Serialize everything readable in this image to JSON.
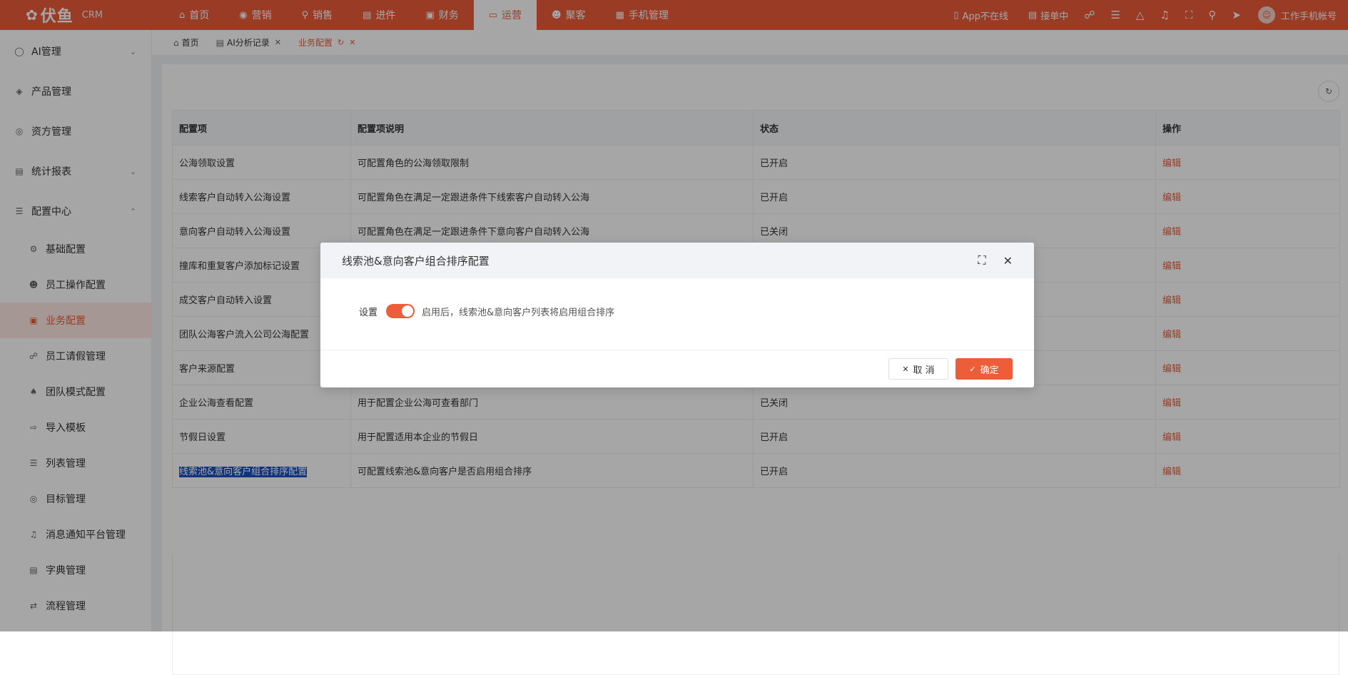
{
  "colors": {
    "brand": "#ed5d3a",
    "highlight": "#1a4fc4"
  },
  "brand": {
    "logo_text": "伏鱼",
    "product": "CRM"
  },
  "nav": [
    {
      "label": "首页",
      "icon": "home-icon"
    },
    {
      "label": "营销",
      "icon": "marketing-icon"
    },
    {
      "label": "销售",
      "icon": "sales-icon"
    },
    {
      "label": "进件",
      "icon": "document-icon"
    },
    {
      "label": "财务",
      "icon": "finance-icon"
    },
    {
      "label": "运营",
      "icon": "operations-icon",
      "active": true
    },
    {
      "label": "聚客",
      "icon": "customers-icon"
    },
    {
      "label": "手机管理",
      "icon": "phone-manage-icon"
    }
  ],
  "topbar": {
    "app_status": "App不在线",
    "order_status": "接单中",
    "account": "工作手机帐号"
  },
  "sidebar": [
    {
      "label": "AI管理",
      "icon": "ai-icon",
      "level": 1,
      "chevron": "down"
    },
    {
      "label": "产品管理",
      "icon": "cube-icon",
      "level": 1
    },
    {
      "label": "资方管理",
      "icon": "funder-icon",
      "level": 1
    },
    {
      "label": "统计报表",
      "icon": "chart-icon",
      "level": 1,
      "chevron": "down"
    },
    {
      "label": "配置中心",
      "icon": "config-icon",
      "level": 1,
      "chevron": "up"
    },
    {
      "label": "基础配置",
      "icon": "gear-icon",
      "level": 2
    },
    {
      "label": "员工操作配置",
      "icon": "user-icon",
      "level": 2
    },
    {
      "label": "业务配置",
      "icon": "briefcase-icon",
      "level": 2,
      "active": true
    },
    {
      "label": "员工请假管理",
      "icon": "leave-icon",
      "level": 2
    },
    {
      "label": "团队模式配置",
      "icon": "team-icon",
      "level": 2
    },
    {
      "label": "导入模板",
      "icon": "import-icon",
      "level": 2
    },
    {
      "label": "列表管理",
      "icon": "list-icon",
      "level": 2
    },
    {
      "label": "目标管理",
      "icon": "target-icon",
      "level": 2
    },
    {
      "label": "消息通知平台管理",
      "icon": "bell-icon",
      "level": 2
    },
    {
      "label": "字典管理",
      "icon": "dictionary-icon",
      "level": 2
    },
    {
      "label": "流程管理",
      "icon": "flow-icon",
      "level": 2
    }
  ],
  "tabs": [
    {
      "label": "首页",
      "icon": "home-icon",
      "closable": false
    },
    {
      "label": "AI分析记录",
      "icon": "record-icon",
      "closable": true
    },
    {
      "label": "业务配置",
      "closable": true,
      "active": true,
      "refresh": true
    }
  ],
  "table": {
    "headers": [
      "配置项",
      "配置项说明",
      "状态",
      "操作"
    ],
    "rows": [
      {
        "name": "公海领取设置",
        "desc": "可配置角色的公海领取限制",
        "status": "已开启",
        "action": "编辑"
      },
      {
        "name": "线索客户自动转入公海设置",
        "desc": "可配置角色在满足一定跟进条件下线索客户自动转入公海",
        "status": "已开启",
        "action": "编辑"
      },
      {
        "name": "意向客户自动转入公海设置",
        "desc": "可配置角色在满足一定跟进条件下意向客户自动转入公海",
        "status": "已关闭",
        "action": "编辑"
      },
      {
        "name": "撞库和重复客户添加标记设置",
        "desc": "",
        "status": "",
        "action": "编辑"
      },
      {
        "name": "成交客户自动转入设置",
        "desc": "",
        "status": "",
        "action": "编辑"
      },
      {
        "name": "团队公海客户流入公司公海配置",
        "desc": "",
        "status": "",
        "action": "编辑"
      },
      {
        "name": "客户来源配置",
        "desc": "",
        "status": "",
        "action": "编辑"
      },
      {
        "name": "企业公海查看配置",
        "desc": "用于配置企业公海可查看部门",
        "status": "已关闭",
        "action": "编辑"
      },
      {
        "name": "节假日设置",
        "desc": "用于配置适用本企业的节假日",
        "status": "已开启",
        "action": "编辑"
      },
      {
        "name": "线索池&意向客户组合排序配置",
        "desc": "可配置线索池&意向客户是否启用组合排序",
        "status": "已开启",
        "action": "编辑",
        "highlighted": true
      }
    ]
  },
  "modal": {
    "title": "线索池&意向客户组合排序配置",
    "setting_label": "设置",
    "switch_on": true,
    "setting_desc": "启用后，线索池&意向客户列表将启用组合排序",
    "cancel_label": "取 消",
    "ok_label": "确定"
  }
}
